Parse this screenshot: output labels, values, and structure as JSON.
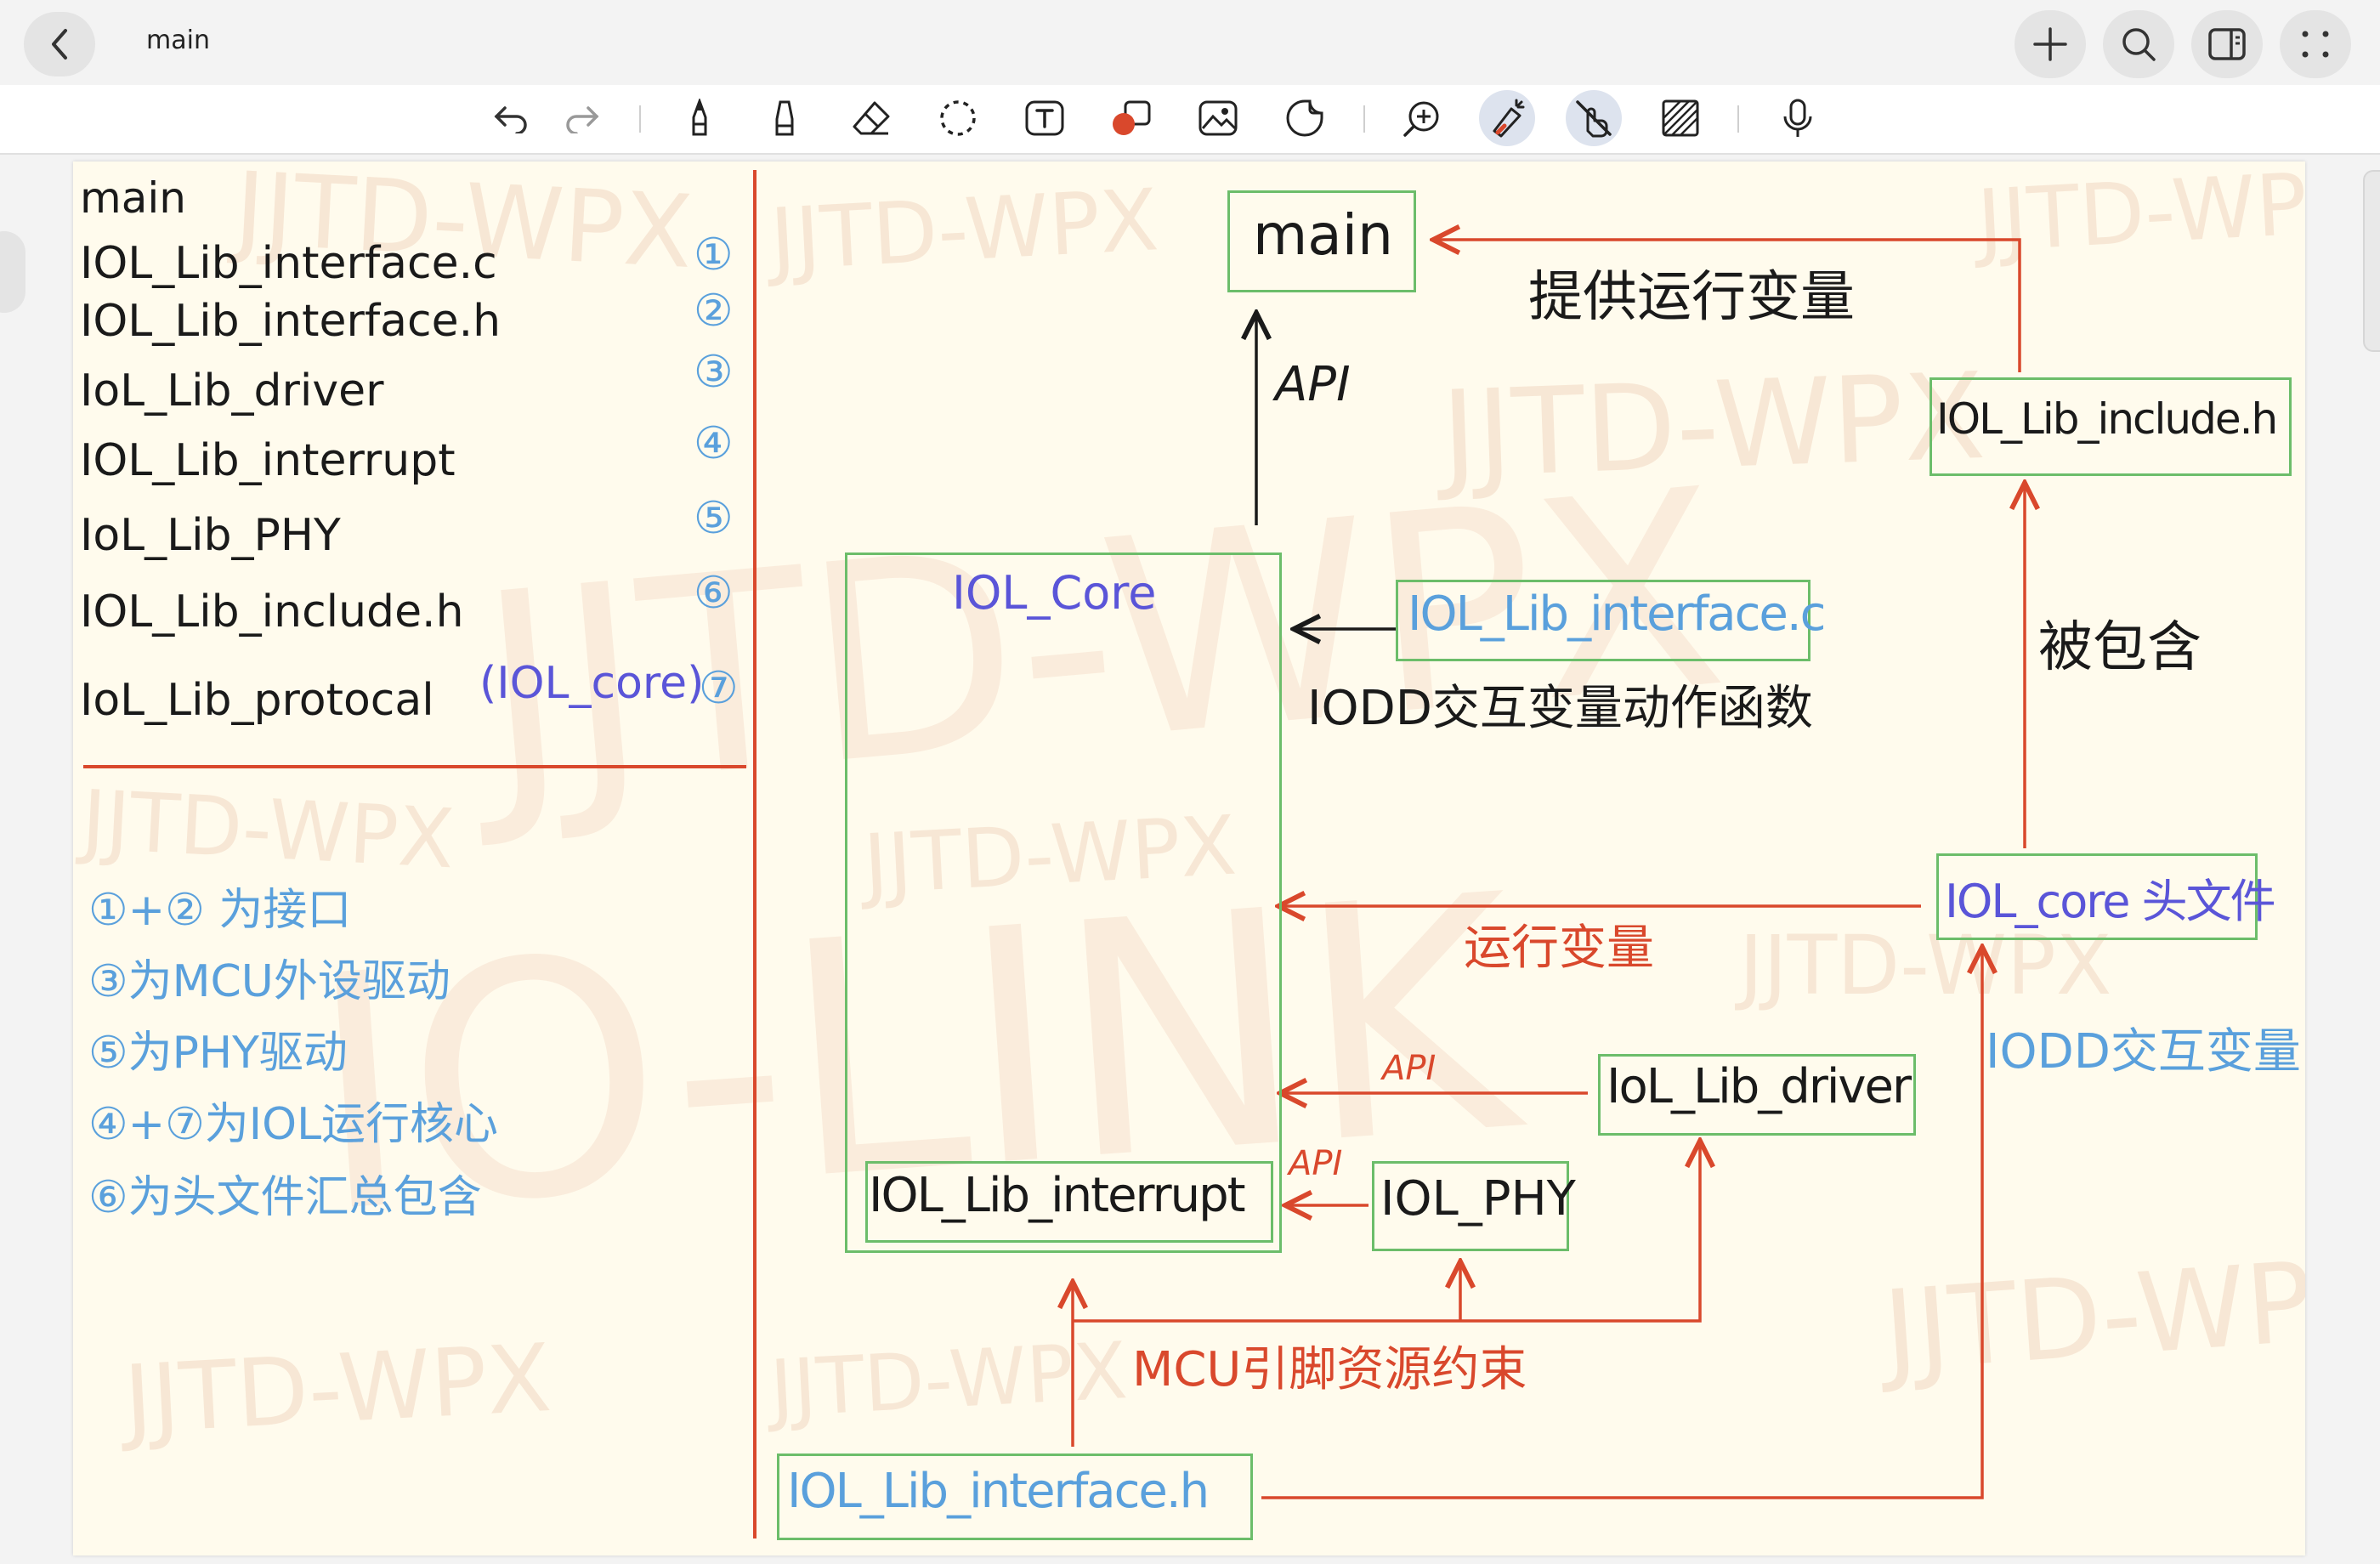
{
  "header": {
    "doc_title": "main"
  },
  "toolbar": {
    "icons": [
      "undo-icon",
      "redo-icon",
      "pen-icon",
      "highlighter-icon",
      "eraser-icon",
      "lasso-icon",
      "text-icon",
      "shapes-icon",
      "image-icon",
      "sticker-icon",
      "zoom-icon",
      "laser-pointer-icon",
      "touch-draw-icon",
      "ruler-hatch-icon",
      "microphone-icon"
    ]
  },
  "left_panel": {
    "files": [
      {
        "name": "main",
        "num": ""
      },
      {
        "name": "IOL_Lib_interface.c",
        "num": "①"
      },
      {
        "name": "IOL_Lib_interface.h",
        "num": "②"
      },
      {
        "name": "IoL_Lib_driver",
        "num": "③"
      },
      {
        "name": "IOL_Lib_interrupt",
        "num": "④"
      },
      {
        "name": "IoL_Lib_PHY",
        "num": "⑤"
      },
      {
        "name": "IOL_Lib_include.h",
        "num": "⑥"
      },
      {
        "name": "IoL_Lib_protocal",
        "num": "⑦",
        "suffix": "(IOL_core)"
      }
    ],
    "notes": [
      "①+② 为接口",
      "③为MCU外设驱动",
      "⑤为PHY驱动",
      "④+⑦为IOL运行核心",
      "⑥为头文件汇总包含"
    ]
  },
  "diagram": {
    "main_box": "main",
    "api_top": "API",
    "provide_vars": "提供运行变量",
    "include_h": "IOL_Lib_include.h",
    "included": "被包含",
    "core_label": "IOL_Core",
    "interface_c": "IOL_Lib_interface.c",
    "iodd_funcs": "IODD交互变量动作函数",
    "core_header": "IOL_core 头文件",
    "run_vars": "运行变量",
    "iodd_vars": "IODD交互变量",
    "api_driver": "API",
    "driver": "IoL_Lib_driver",
    "api_phy": "API",
    "phy": "IOL_PHY",
    "interrupt": "IOL_Lib_interrupt",
    "mcu_constraint": "MCU引脚资源约束",
    "interface_h": "IOL_Lib_interface.h"
  },
  "watermarks": [
    "JJTD-WPX",
    "IO-LINK"
  ],
  "colors": {
    "paper": "#fffbed",
    "ink": "#1a1a1a",
    "red": "#d9482c",
    "blue": "#5aa0dc",
    "purple": "#5a55d8",
    "green": "#6cbd6a"
  }
}
